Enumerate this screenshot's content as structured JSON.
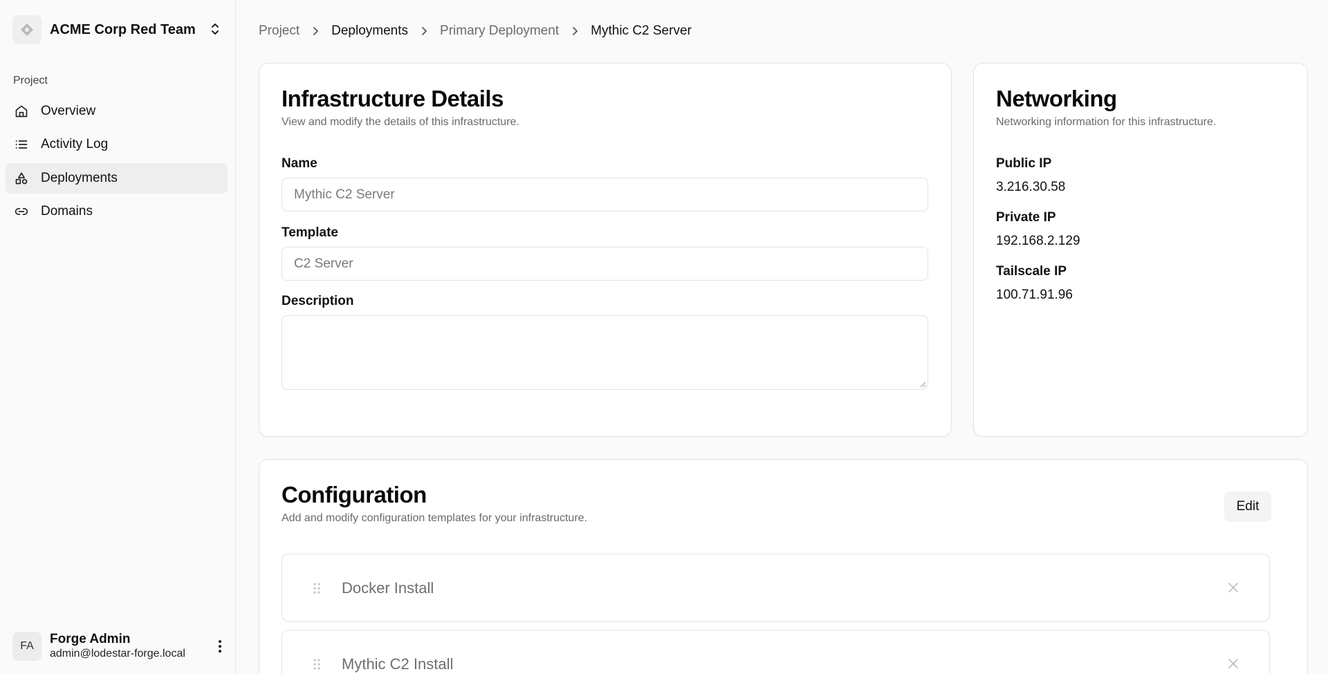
{
  "team": {
    "name": "ACME Corp Red Team"
  },
  "sidebar": {
    "section_label": "Project",
    "items": [
      {
        "label": "Overview",
        "icon": "home-icon"
      },
      {
        "label": "Activity Log",
        "icon": "list-icon"
      },
      {
        "label": "Deployments",
        "icon": "shapes-icon",
        "active": true
      },
      {
        "label": "Domains",
        "icon": "link-icon"
      }
    ]
  },
  "user": {
    "initials": "FA",
    "name": "Forge Admin",
    "email": "admin@lodestar-forge.local"
  },
  "breadcrumb": [
    "Project",
    "Deployments",
    "Primary Deployment",
    "Mythic C2 Server"
  ],
  "details": {
    "title": "Infrastructure Details",
    "subtitle": "View and modify the details of this infrastructure.",
    "name_label": "Name",
    "name_value": "Mythic C2 Server",
    "template_label": "Template",
    "template_value": "C2 Server",
    "description_label": "Description",
    "description_value": ""
  },
  "networking": {
    "title": "Networking",
    "subtitle": "Networking information for this infrastructure.",
    "public_ip_label": "Public IP",
    "public_ip": "3.216.30.58",
    "private_ip_label": "Private IP",
    "private_ip": "192.168.2.129",
    "tailscale_ip_label": "Tailscale IP",
    "tailscale_ip": "100.71.91.96"
  },
  "configuration": {
    "title": "Configuration",
    "subtitle": "Add and modify configuration templates for your infrastructure.",
    "edit_label": "Edit",
    "items": [
      {
        "name": "Docker Install"
      },
      {
        "name": "Mythic C2 Install"
      }
    ]
  }
}
